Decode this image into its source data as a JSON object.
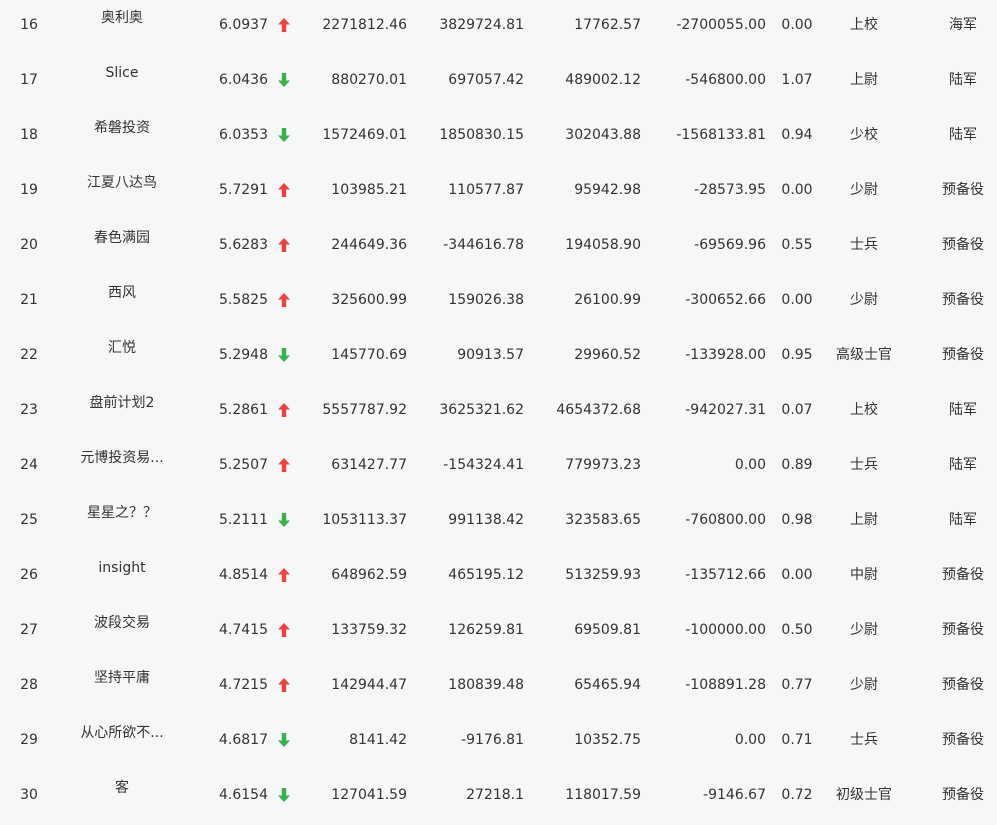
{
  "colors": {
    "up": "#f0423a",
    "down": "#37b24a",
    "text": "#333333",
    "background": "#f6f7f9"
  },
  "rows": [
    {
      "rank": "16",
      "name": "奥利奥",
      "score": "6.0937",
      "trend": "up",
      "v1": "2271812.46",
      "v2": "3829724.81",
      "v3": "17762.57",
      "v4": "-2700055.00",
      "ratio": "0.00",
      "title": "上校",
      "branch": "海军"
    },
    {
      "rank": "17",
      "name": "Slice",
      "score": "6.0436",
      "trend": "down",
      "v1": "880270.01",
      "v2": "697057.42",
      "v3": "489002.12",
      "v4": "-546800.00",
      "ratio": "1.07",
      "title": "上尉",
      "branch": "陆军"
    },
    {
      "rank": "18",
      "name": "希磐投资",
      "score": "6.0353",
      "trend": "down",
      "v1": "1572469.01",
      "v2": "1850830.15",
      "v3": "302043.88",
      "v4": "-1568133.81",
      "ratio": "0.94",
      "title": "少校",
      "branch": "陆军"
    },
    {
      "rank": "19",
      "name": "江夏八达鸟",
      "score": "5.7291",
      "trend": "up",
      "v1": "103985.21",
      "v2": "110577.87",
      "v3": "95942.98",
      "v4": "-28573.95",
      "ratio": "0.00",
      "title": "少尉",
      "branch": "预备役"
    },
    {
      "rank": "20",
      "name": "春色满园",
      "score": "5.6283",
      "trend": "up",
      "v1": "244649.36",
      "v2": "-344616.78",
      "v3": "194058.90",
      "v4": "-69569.96",
      "ratio": "0.55",
      "title": "士兵",
      "branch": "预备役"
    },
    {
      "rank": "21",
      "name": "西风",
      "score": "5.5825",
      "trend": "up",
      "v1": "325600.99",
      "v2": "159026.38",
      "v3": "26100.99",
      "v4": "-300652.66",
      "ratio": "0.00",
      "title": "少尉",
      "branch": "预备役"
    },
    {
      "rank": "22",
      "name": "汇悦",
      "score": "5.2948",
      "trend": "down",
      "v1": "145770.69",
      "v2": "90913.57",
      "v3": "29960.52",
      "v4": "-133928.00",
      "ratio": "0.95",
      "title": "高级士官",
      "branch": "预备役"
    },
    {
      "rank": "23",
      "name": "盘前计划2",
      "score": "5.2861",
      "trend": "up",
      "v1": "5557787.92",
      "v2": "3625321.62",
      "v3": "4654372.68",
      "v4": "-942027.31",
      "ratio": "0.07",
      "title": "上校",
      "branch": "陆军"
    },
    {
      "rank": "24",
      "name": "元博投资易...",
      "score": "5.2507",
      "trend": "up",
      "v1": "631427.77",
      "v2": "-154324.41",
      "v3": "779973.23",
      "v4": "0.00",
      "ratio": "0.89",
      "title": "士兵",
      "branch": "陆军"
    },
    {
      "rank": "25",
      "name": "星星之？？",
      "score": "5.2111",
      "trend": "down",
      "v1": "1053113.37",
      "v2": "991138.42",
      "v3": "323583.65",
      "v4": "-760800.00",
      "ratio": "0.98",
      "title": "上尉",
      "branch": "陆军"
    },
    {
      "rank": "26",
      "name": "insight",
      "score": "4.8514",
      "trend": "up",
      "v1": "648962.59",
      "v2": "465195.12",
      "v3": "513259.93",
      "v4": "-135712.66",
      "ratio": "0.00",
      "title": "中尉",
      "branch": "预备役"
    },
    {
      "rank": "27",
      "name": "波段交易",
      "score": "4.7415",
      "trend": "up",
      "v1": "133759.32",
      "v2": "126259.81",
      "v3": "69509.81",
      "v4": "-100000.00",
      "ratio": "0.50",
      "title": "少尉",
      "branch": "预备役"
    },
    {
      "rank": "28",
      "name": "坚持平庸",
      "score": "4.7215",
      "trend": "up",
      "v1": "142944.47",
      "v2": "180839.48",
      "v3": "65465.94",
      "v4": "-108891.28",
      "ratio": "0.77",
      "title": "少尉",
      "branch": "预备役"
    },
    {
      "rank": "29",
      "name": "从心所欲不...",
      "score": "4.6817",
      "trend": "down",
      "v1": "8141.42",
      "v2": "-9176.81",
      "v3": "10352.75",
      "v4": "0.00",
      "ratio": "0.71",
      "title": "士兵",
      "branch": "预备役"
    },
    {
      "rank": "30",
      "name": "客",
      "score": "4.6154",
      "trend": "down",
      "v1": "127041.59",
      "v2": "27218.1",
      "v3": "118017.59",
      "v4": "-9146.67",
      "ratio": "0.72",
      "title": "初级士官",
      "branch": "预备役"
    }
  ]
}
